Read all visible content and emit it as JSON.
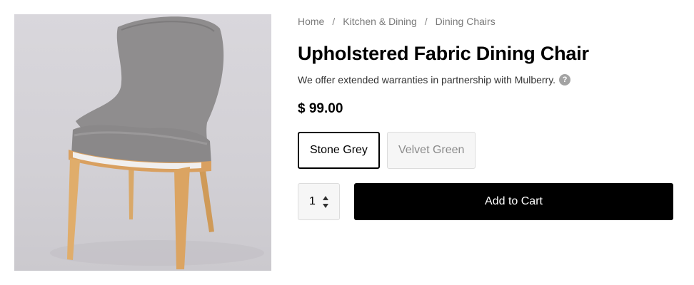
{
  "product": {
    "image_alt": "Upholstered Fabric Dining Chair",
    "breadcrumb": [
      "Home",
      "Kitchen & Dining",
      "Dining Chairs"
    ],
    "breadcrumb_separator": "/",
    "title": "Upholstered Fabric Dining Chair",
    "warranty_text": "We offer extended warranties in partnership with Mulberry.",
    "help_icon": "?",
    "price": "$ 99.00",
    "variants": [
      {
        "label": "Stone Grey",
        "selected": true
      },
      {
        "label": "Velvet Green",
        "selected": false
      }
    ],
    "quantity": "1",
    "add_to_cart_label": "Add to Cart"
  },
  "colors": {
    "button_bg": "#000000",
    "button_text": "#ffffff",
    "muted_text": "#7a7a7a"
  }
}
